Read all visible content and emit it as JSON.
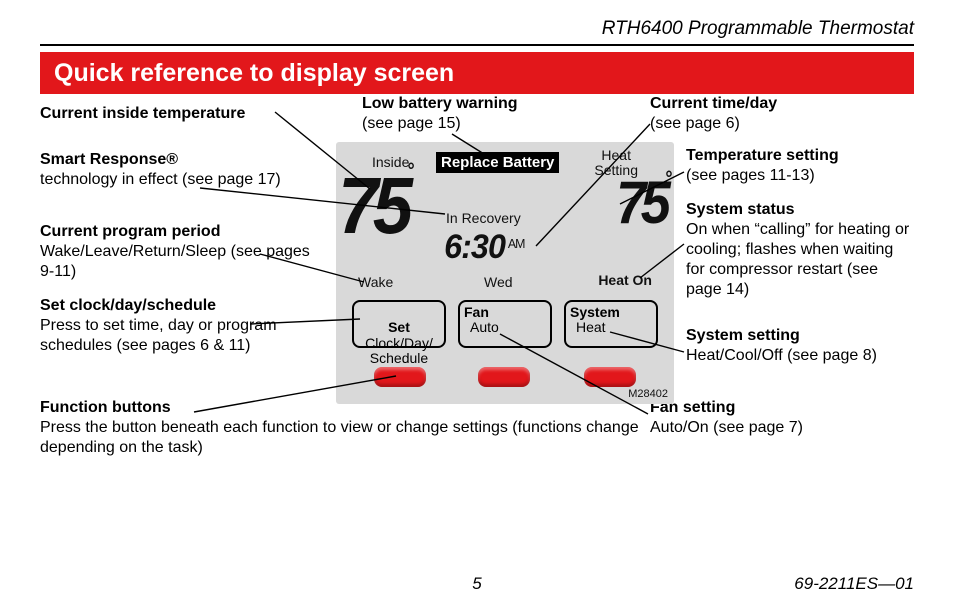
{
  "header": {
    "product": "RTH6400 Programmable Thermostat",
    "title": "Quick reference to display screen"
  },
  "callouts": {
    "inside_temp": {
      "h": "Current inside temperature"
    },
    "smart_response": {
      "h": "Smart Response®",
      "d": "technology in effect (see page 17)"
    },
    "program_period": {
      "h": "Current program period",
      "d": "Wake/Leave/Return/Sleep (see pages 9-11)"
    },
    "set_clock": {
      "h": "Set clock/day/schedule",
      "d": "Press to set time, day or program schedules (see pages 6 & 11)"
    },
    "function_buttons": {
      "h": "Function buttons",
      "d": "Press the button beneath each function to view or change settings (functions change depending on the task)"
    },
    "low_battery": {
      "h": "Low battery warning",
      "d": "(see page 15)"
    },
    "current_time": {
      "h": "Current time/day",
      "d": "(see page 6)"
    },
    "temp_setting": {
      "h": "Temperature setting",
      "d": "(see pages 11-13)"
    },
    "system_status": {
      "h": "System status",
      "d": "On when “calling” for heating or cooling; flashes when waiting for compressor restart (see page 14)"
    },
    "system_setting": {
      "h": "System setting",
      "d": "Heat/Cool/Off (see page 8)"
    },
    "fan_setting": {
      "h": "Fan setting",
      "d": "Auto/On (see page 7)"
    }
  },
  "lcd": {
    "inside_label": "Inside",
    "replace_battery": "Replace Battery",
    "heat_setting_label": "Heat\nSetting",
    "in_recovery": "In Recovery",
    "temp_current": "75",
    "temp_set": "75",
    "degree": "°",
    "time": "6:30",
    "ampm": "AM",
    "period": "Wake",
    "day": "Wed",
    "heat_on": "Heat On",
    "btn_set_bold": "Set",
    "btn_set_rest": " Clock/Day/\nSchedule",
    "btn_fan_h": "Fan",
    "btn_fan_v": "Auto",
    "btn_sys_h": "System",
    "btn_sys_v": "Heat",
    "model_code": "M28402"
  },
  "footer": {
    "page": "5",
    "doc": "69-2211ES—01"
  }
}
